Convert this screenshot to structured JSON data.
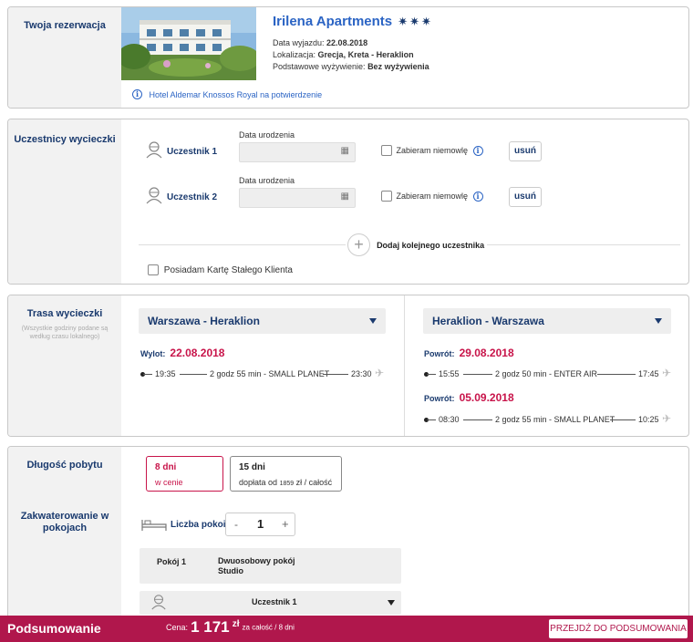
{
  "reservation": {
    "section_title": "Twoja rezerwacja",
    "hotel_name": "Irilena Apartments",
    "departure_label": "Data wyjazdu:",
    "departure_date": "22.08.2018",
    "location_label": "Lokalizacja:",
    "location": "Grecja, Kreta - Heraklion",
    "board_label": "Podstawowe wyżywienie:",
    "board": "Bez wyżywienia",
    "stars": 3,
    "confirmation_note": "Hotel Aldemar Knossos Royal na potwierdzenie",
    "colors": {
      "title": "#2b64c4",
      "star": "#1a3a6e"
    }
  },
  "participants": {
    "section_title": "Uczestnicy wycieczki",
    "birth_date_label": "Data urodzenia",
    "infant_label": "Zabieram niemowlę",
    "remove_label": "usuń",
    "items": [
      {
        "label": "Uczestnik 1"
      },
      {
        "label": "Uczestnik 2"
      }
    ],
    "add_label": "Dodaj kolejnego uczestnika",
    "loyalty_label": "Posiadam Kartę Stałego Klienta"
  },
  "route": {
    "section_title": "Trasa wycieczki",
    "note": "(Wszystkie godziny podane są według czasu lokalnego)",
    "outbound": {
      "select": "Warszawa - Heraklion",
      "label": "Wylot:",
      "date": "22.08.2018",
      "dep": "19:35",
      "info": "2 godz 55 min - SMALL PLANET",
      "arr": "23:30"
    },
    "return": {
      "select": "Heraklion - Warszawa",
      "flights": [
        {
          "label": "Powrót:",
          "date": "29.08.2018",
          "dep": "15:55",
          "info": "2 godz 50 min - ENTER AIR",
          "arr": "17:45"
        },
        {
          "label": "Powrót:",
          "date": "05.09.2018",
          "dep": "08:30",
          "info": "2 godz 55 min - SMALL PLANET",
          "arr": "10:25"
        }
      ]
    }
  },
  "stay": {
    "section_title": "Długość pobytu",
    "options": [
      {
        "title": "8 dni",
        "sub": "w cenie",
        "selected": true
      },
      {
        "title": "15 dni",
        "sub_prefix": "dopłata od",
        "sub_amount": "1859",
        "sub_suffix": "zł / całość",
        "selected": false
      }
    ]
  },
  "accommodation": {
    "section_title": "Zakwaterowanie w pokojach",
    "rooms_label": "Liczba pokoi",
    "rooms_count": "1",
    "minus": "-",
    "plus": "+",
    "room": {
      "label": "Pokój 1",
      "type_line1": "Dwuosobowy pokój",
      "type_line2": "Studio"
    },
    "participant_select": "Uczestnik 1"
  },
  "footer": {
    "title": "Podsumowanie",
    "price_label": "Cena:",
    "price": "1 171",
    "currency": "zł",
    "price_note": "za całość / 8 dni",
    "button": "PRZEJDŹ DO PODSUMOWANIA",
    "color": "#b0174c"
  }
}
